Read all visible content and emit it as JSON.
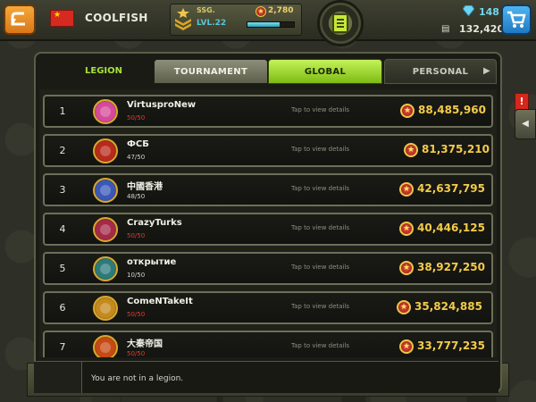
{
  "header": {
    "back_icon": "back-arrow-icon",
    "player_name": "COOLFISH",
    "flag": "china-flag",
    "rank_title": "SSG.",
    "rank_level": "LVL.22",
    "xp_value": "2,780",
    "xp_progress": 0.7,
    "gems": "148",
    "cash": "132,420",
    "mission_icon": "clipboard-icon",
    "shop_icon": "shopping-cart-icon"
  },
  "tabs": {
    "legion": "LEGION",
    "tournament": "TOURNAMENT",
    "global": "GLOBAL",
    "personal": "PERSONAL"
  },
  "rows": [
    {
      "rank": "1",
      "name": "VirtusproNew",
      "members": "50/50",
      "members_color": "#e23b2c",
      "tap": "Tap to view details",
      "score": "88,485,960",
      "emblem_color": "#d54a9a"
    },
    {
      "rank": "2",
      "name": "ФСБ",
      "members": "47/50",
      "members_color": "#d5d5cb",
      "tap": "Tap to view details",
      "score": "81,375,210",
      "emblem_color": "#b82a1a"
    },
    {
      "rank": "3",
      "name": "中國香港",
      "members": "48/50",
      "members_color": "#d5d5cb",
      "tap": "Tap to view details",
      "score": "42,637,795",
      "emblem_color": "#3a58b8"
    },
    {
      "rank": "4",
      "name": "CrazyTurks",
      "members": "50/50",
      "members_color": "#e23b2c",
      "tap": "Tap to view details",
      "score": "40,446,125",
      "emblem_color": "#a42a48"
    },
    {
      "rank": "5",
      "name": "открытие",
      "members": "10/50",
      "members_color": "#d5d5cb",
      "tap": "Tap to view details",
      "score": "38,927,250",
      "emblem_color": "#2c7a7a"
    },
    {
      "rank": "6",
      "name": "ComeNTakeIt",
      "members": "50/50",
      "members_color": "#e23b2c",
      "tap": "Tap to view details",
      "score": "35,824,885",
      "emblem_color": "#c48a1e"
    },
    {
      "rank": "7",
      "name": "大秦帝国",
      "members": "50/50",
      "members_color": "#e23b2c",
      "tap": "Tap to view details",
      "score": "33,777,235",
      "emblem_color": "#c64a14"
    }
  ],
  "status": "You are not in a legion.",
  "side": {
    "alert": "!",
    "arrow": "◀"
  }
}
